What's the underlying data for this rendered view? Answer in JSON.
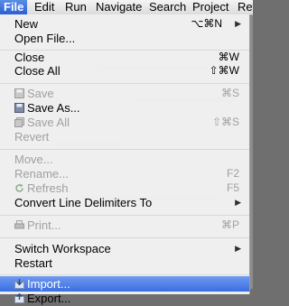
{
  "menubar": {
    "items": [
      {
        "label": "File"
      },
      {
        "label": "Edit"
      },
      {
        "label": "Run"
      },
      {
        "label": "Navigate"
      },
      {
        "label": "Search"
      },
      {
        "label": "Project"
      },
      {
        "label": "Ref"
      }
    ]
  },
  "menu": {
    "new": {
      "label": "New",
      "shortcut": "⌥⌘N"
    },
    "open_file": {
      "label": "Open File..."
    },
    "close": {
      "label": "Close",
      "shortcut": "⌘W"
    },
    "close_all": {
      "label": "Close All",
      "shortcut": "⇧⌘W"
    },
    "save": {
      "label": "Save",
      "shortcut": "⌘S"
    },
    "save_as": {
      "label": "Save As..."
    },
    "save_all": {
      "label": "Save All",
      "shortcut": "⇧⌘S"
    },
    "revert": {
      "label": "Revert"
    },
    "move": {
      "label": "Move..."
    },
    "rename": {
      "label": "Rename...",
      "shortcut": "F2"
    },
    "refresh": {
      "label": "Refresh",
      "shortcut": "F5"
    },
    "convert": {
      "label": "Convert Line Delimiters To"
    },
    "print": {
      "label": "Print...",
      "shortcut": "⌘P"
    },
    "switch_workspace": {
      "label": "Switch Workspace"
    },
    "restart": {
      "label": "Restart"
    },
    "import": {
      "label": "Import..."
    },
    "export": {
      "label": "Export..."
    }
  },
  "icons": {
    "save": "floppy-disk-icon",
    "save_as": "floppy-disk-icon",
    "save_all": "floppy-disks-icon",
    "refresh": "refresh-icon",
    "print": "printer-icon",
    "import": "import-icon",
    "export": "export-icon",
    "submenu": "triangle-right-icon"
  },
  "colors": {
    "highlight": "#3a6ee0",
    "disabled_text": "#a0a0a0"
  }
}
